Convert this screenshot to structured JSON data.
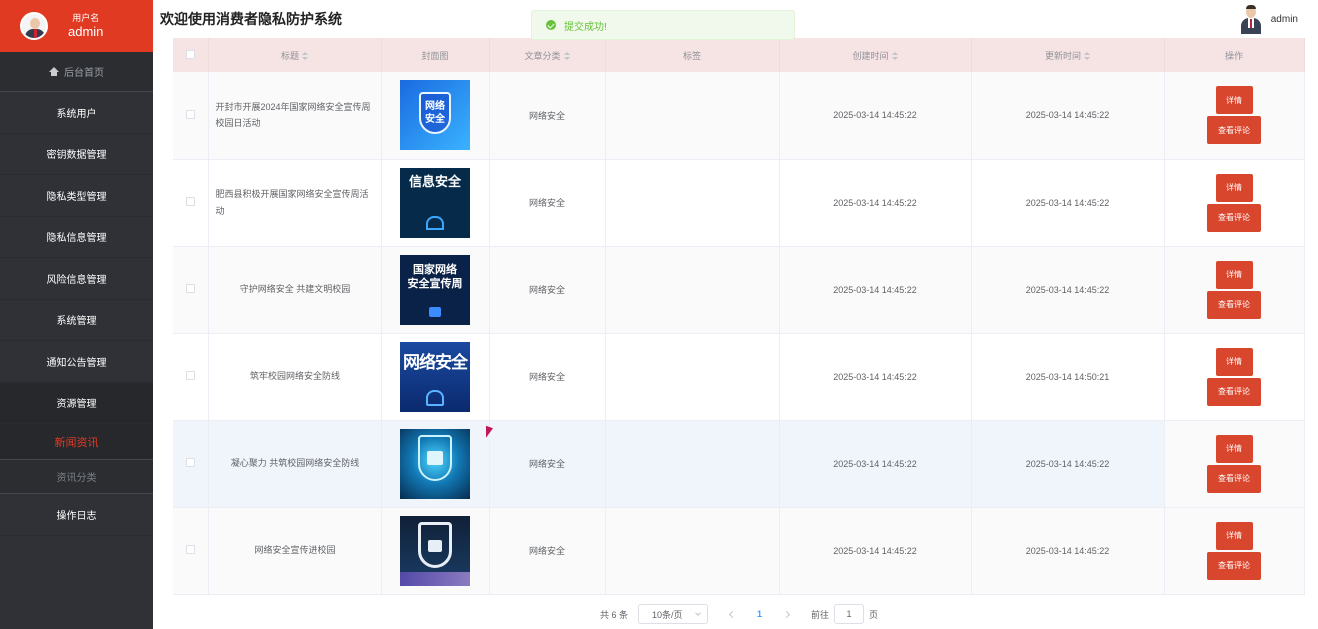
{
  "sidebar": {
    "user_label": "用户名",
    "user_name": "admin",
    "home": "后台首页",
    "items": [
      "系统用户",
      "密钥数据管理",
      "隐私类型管理",
      "隐私信息管理",
      "风险信息管理",
      "系统管理",
      "通知公告管理",
      "资源管理"
    ],
    "active": "新闻资讯",
    "sub": "资讯分类",
    "last": "操作日志"
  },
  "header": {
    "title": "欢迎使用消费者隐私防护系统",
    "user": "admin"
  },
  "toast": {
    "text": "提交成功!"
  },
  "table": {
    "columns": [
      "标题",
      "封面图",
      "文章分类",
      "标签",
      "创建时间",
      "更新时间",
      "操作"
    ],
    "rows": [
      {
        "title": "开封市开展2024年国家网络安全宣传周校园日活动",
        "cover_text": "网络\n安全",
        "category": "网络安全",
        "tag": "",
        "created": "2025-03-14 14:45:22",
        "updated": "2025-03-14 14:45:22"
      },
      {
        "title": "肥西县积极开展国家网络安全宣传周活动",
        "cover_text": "信息安全",
        "category": "网络安全",
        "tag": "",
        "created": "2025-03-14 14:45:22",
        "updated": "2025-03-14 14:45:22"
      },
      {
        "title": "守护网络安全 共建文明校园",
        "cover_text": "国家网络\n安全宣传周",
        "category": "网络安全",
        "tag": "",
        "created": "2025-03-14 14:45:22",
        "updated": "2025-03-14 14:45:22"
      },
      {
        "title": "筑牢校园网络安全防线",
        "cover_text": "网络安全",
        "category": "网络安全",
        "tag": "",
        "created": "2025-03-14 14:45:22",
        "updated": "2025-03-14 14:50:21"
      },
      {
        "title": "凝心聚力 共筑校园网络安全防线",
        "cover_text": "",
        "category": "网络安全",
        "tag": "",
        "created": "2025-03-14 14:45:22",
        "updated": "2025-03-14 14:45:22"
      },
      {
        "title": "网络安全宣传进校园",
        "cover_text": "",
        "category": "网络安全",
        "tag": "",
        "created": "2025-03-14 14:45:22",
        "updated": "2025-03-14 14:45:22"
      }
    ],
    "detail_label": "详情",
    "comment_label": "查看评论"
  },
  "pagination": {
    "total": "共 6 条",
    "page_size": "10条/页",
    "current_page": "1",
    "goto_label": "前往",
    "goto_value": "1",
    "page_unit": "页"
  },
  "colors": {
    "brand": "#e13a22",
    "sidebar": "#2f3136",
    "button": "#d9462e",
    "header_row": "#f6e3e3"
  }
}
